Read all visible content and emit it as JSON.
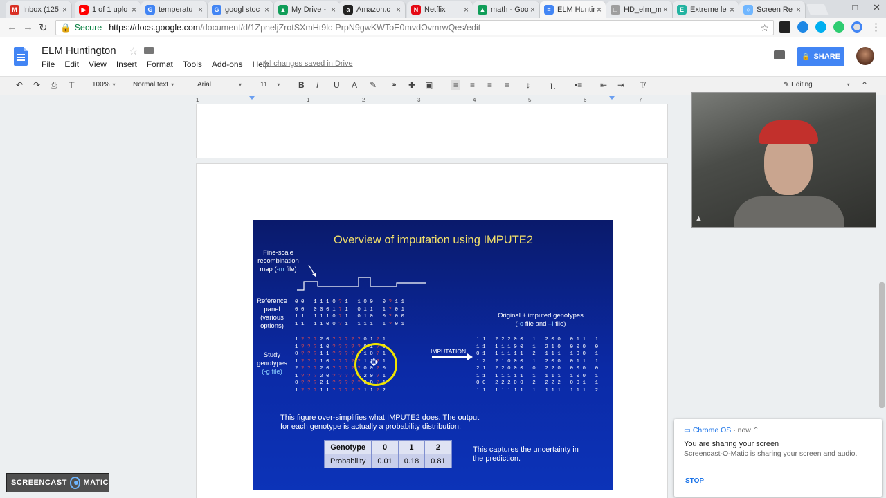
{
  "browser": {
    "tabs": [
      {
        "title": "Inbox (125",
        "icon": "gmail-icon",
        "color": "#d93025",
        "glyph": "M"
      },
      {
        "title": "1 of 1 uplo",
        "icon": "youtube-icon",
        "color": "#ff0000",
        "glyph": "▶"
      },
      {
        "title": "temperatu",
        "icon": "google-icon",
        "color": "#4285f4",
        "glyph": "G"
      },
      {
        "title": "googl stoc",
        "icon": "google-icon",
        "color": "#4285f4",
        "glyph": "G"
      },
      {
        "title": "My Drive -",
        "icon": "drive-icon",
        "color": "#0f9d58",
        "glyph": "▲"
      },
      {
        "title": "Amazon.c",
        "icon": "amazon-icon",
        "color": "#222222",
        "glyph": "a"
      },
      {
        "title": "Netflix",
        "icon": "netflix-icon",
        "color": "#e50914",
        "glyph": "N"
      },
      {
        "title": "math - Goo",
        "icon": "drive-icon",
        "color": "#0f9d58",
        "glyph": "▲"
      },
      {
        "title": "ELM Huntin",
        "icon": "docs-icon",
        "color": "#4285f4",
        "glyph": "≡"
      },
      {
        "title": "HD_elm_m",
        "icon": "file-icon",
        "color": "#9e9e9e",
        "glyph": "□"
      },
      {
        "title": "Extreme le",
        "icon": "extension-icon",
        "color": "#23b3a1",
        "glyph": "E"
      },
      {
        "title": "Screen Re",
        "icon": "screencast-icon",
        "color": "#6fb6ff",
        "glyph": "○"
      }
    ],
    "active_tab": 8,
    "secure_label": "Secure",
    "url_host": "https://docs.google.com",
    "url_path": "/document/d/1ZpneljZrotSXmHt9lc-PrpN9gwKWToE0mvdOvmrwQes/edit"
  },
  "docs": {
    "title": "ELM Huntington",
    "menus": [
      "File",
      "Edit",
      "View",
      "Insert",
      "Format",
      "Tools",
      "Add-ons",
      "Help"
    ],
    "saved_status": "All changes saved in Drive",
    "share_label": "SHARE",
    "toolbar": {
      "zoom": "100%",
      "style": "Normal text",
      "font": "Arial",
      "size": "11",
      "mode": "Editing"
    },
    "ruler_numbers": [
      "1",
      "1",
      "2",
      "3",
      "4",
      "5",
      "6",
      "7"
    ]
  },
  "slide": {
    "title": "Overview of imputation using IMPUTE2",
    "map_label_1": "Fine-scale",
    "map_label_2": "recombination",
    "map_label_3": "map (",
    "map_label_flag": "-m",
    "map_label_4": " file)",
    "ref_label": [
      "Reference",
      "panel",
      "(various",
      "options)"
    ],
    "study_label_1": "Study",
    "study_label_2": "genotypes",
    "study_label_flag": "(-g file)",
    "imputation_label": "IMPUTATION",
    "output_label_1": "Original + imputed genotypes",
    "output_label_2a": "(",
    "output_flag_o": "-o",
    "output_label_2b": " file and ",
    "output_flag_i": "–i",
    "output_label_2c": " file)",
    "reference_rows": [
      "0 0   1 1 1 0 ? 1   1 0 0   0 ? 1 1",
      "0 0   0 0 0 1 ? 1   0 1 1   1 ? 0 1",
      "1 1   1 1 1 0 ? 1   0 1 0   0 ? 0 0",
      "1 1   1 1 0 0 ? 1   1 1 1   1 ? 0 1"
    ],
    "study_rows": [
      "1 ? ? ? 2 0 ? ? ? ? ? 0 1 ? 1",
      "1 ? ? ? 1 0 ? ? ? ? ? 0 1 ? 0",
      "0 ? ? ? 1 1 ? ? ? ? ? 1 0 ? 1",
      "1 ? ? ? 1 0 ? ? ? ? ? 1 1 ? 1",
      "2 ? ? ? 2 0 ? ? ? ? ? 0 0 ? 0",
      "1 ? ? ? 2 0 ? ? ? ? ? 2 0 ? 1",
      "0 ? ? ? 2 1 ? ? ? ? ? 0 0 ? 1",
      "1 ? ? ? 1 1 ? ? ? ? ? 1 1 ? 2"
    ],
    "output_rows": [
      "1 1   2 2 2 0 0   1   2 0 0   0 1 1   1",
      "1 1   1 1 1 0 0   1   2 1 0   0 0 0   0",
      "0 1   1 1 1 1 1   2   1 1 1   1 0 0   1",
      "1 2   2 1 0 0 0   1   2 0 0   0 1 1   1",
      "2 1   2 2 0 0 0   0   2 2 0   0 0 0   0",
      "1 1   1 1 1 1 1   1   1 1 1   1 0 0   1",
      "0 0   2 2 2 0 0   2   2 2 2   0 0 1   1",
      "1 1   1 1 1 1 1   1   1 1 1   1 1 1   2"
    ],
    "note_line_1": "This figure over-simplifies what IMPUTE2 does. The output",
    "note_line_2": "for each genotype is actually a probability distribution:",
    "table": {
      "header": [
        "Genotype",
        "0",
        "1",
        "2"
      ],
      "row": [
        "Probability",
        "0.01",
        "0.18",
        "0.81"
      ]
    },
    "uncertainty_1": "This captures the uncertainty in",
    "uncertainty_2": "the prediction."
  },
  "notification": {
    "app": "Chrome OS",
    "time": " · now ⌃",
    "title": "You are sharing your screen",
    "message": "Screencast-O-Matic is sharing your screen and audio.",
    "action": "STOP"
  },
  "watermark": {
    "left": "SCREENCAST",
    "right": "MATIC"
  },
  "colors": {
    "slide_title": "#f4e16a",
    "question_mark": "#e14a4a",
    "flag_text": "#8bd0ff",
    "share_button": "#4285f4"
  }
}
